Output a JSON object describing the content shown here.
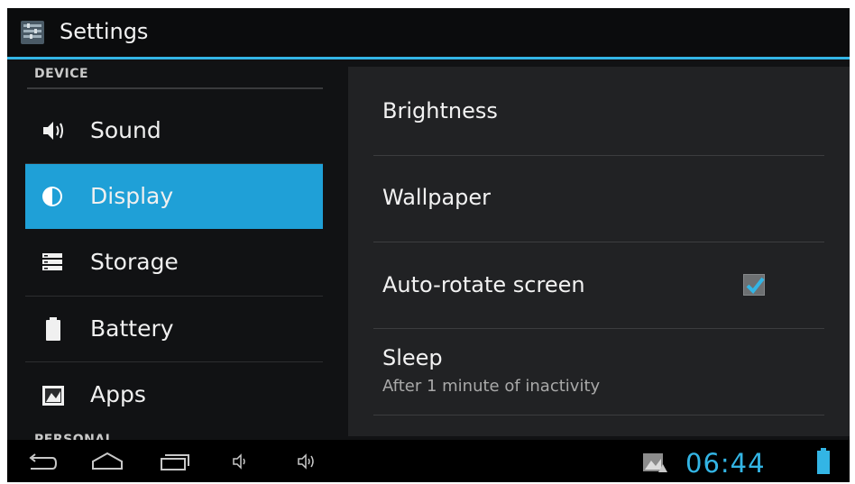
{
  "action_bar": {
    "title": "Settings",
    "icon": "settings-app-icon"
  },
  "sidebar": {
    "section_device": "DEVICE",
    "section_personal": "PERSONAL",
    "items": [
      {
        "label": "Sound",
        "icon": "speaker-icon"
      },
      {
        "label": "Display",
        "icon": "brightness-icon",
        "selected": true
      },
      {
        "label": "Storage",
        "icon": "storage-icon"
      },
      {
        "label": "Battery",
        "icon": "battery-icon"
      },
      {
        "label": "Apps",
        "icon": "apps-icon"
      }
    ]
  },
  "display_settings": {
    "brightness": {
      "title": "Brightness"
    },
    "wallpaper": {
      "title": "Wallpaper"
    },
    "auto_rotate": {
      "title": "Auto-rotate screen",
      "checked": true
    },
    "sleep": {
      "title": "Sleep",
      "summary": "After 1 minute of inactivity"
    }
  },
  "system_bar": {
    "buttons": [
      "back-icon",
      "home-icon",
      "recent-apps-icon",
      "volume-down-icon",
      "volume-up-icon"
    ],
    "status_icons": [
      "screenshot-notification-icon",
      "battery-icon"
    ],
    "clock": "06:44"
  },
  "colors": {
    "accent": "#33b5e5",
    "selected_item": "#1fa0d7",
    "background": "#111214",
    "panel": "#212224"
  }
}
